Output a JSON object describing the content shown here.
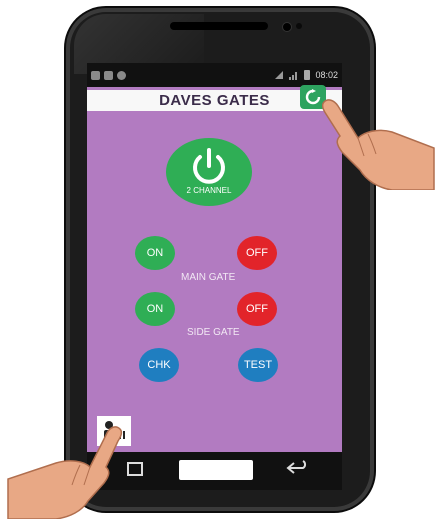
{
  "status_bar": {
    "time": "08:02"
  },
  "header": {
    "title": "DAVES GATES",
    "settings_icon": "refresh-icon"
  },
  "power": {
    "label": "2 CHANNEL",
    "icon": "power-icon"
  },
  "main_gate": {
    "on_label": "ON",
    "off_label": "OFF",
    "group_label": "MAIN GATE"
  },
  "side_gate": {
    "on_label": "ON",
    "off_label": "OFF",
    "group_label": "SIDE GATE"
  },
  "actions": {
    "check_label": "CHK",
    "test_label": "TEST"
  },
  "bottom_bar": {
    "icon": "user-icon"
  },
  "colors": {
    "screen_bg": "#b27bc1",
    "green": "#2fae55",
    "red": "#e2242a",
    "blue": "#1f7ec0",
    "title_text": "#3b2c4a"
  }
}
